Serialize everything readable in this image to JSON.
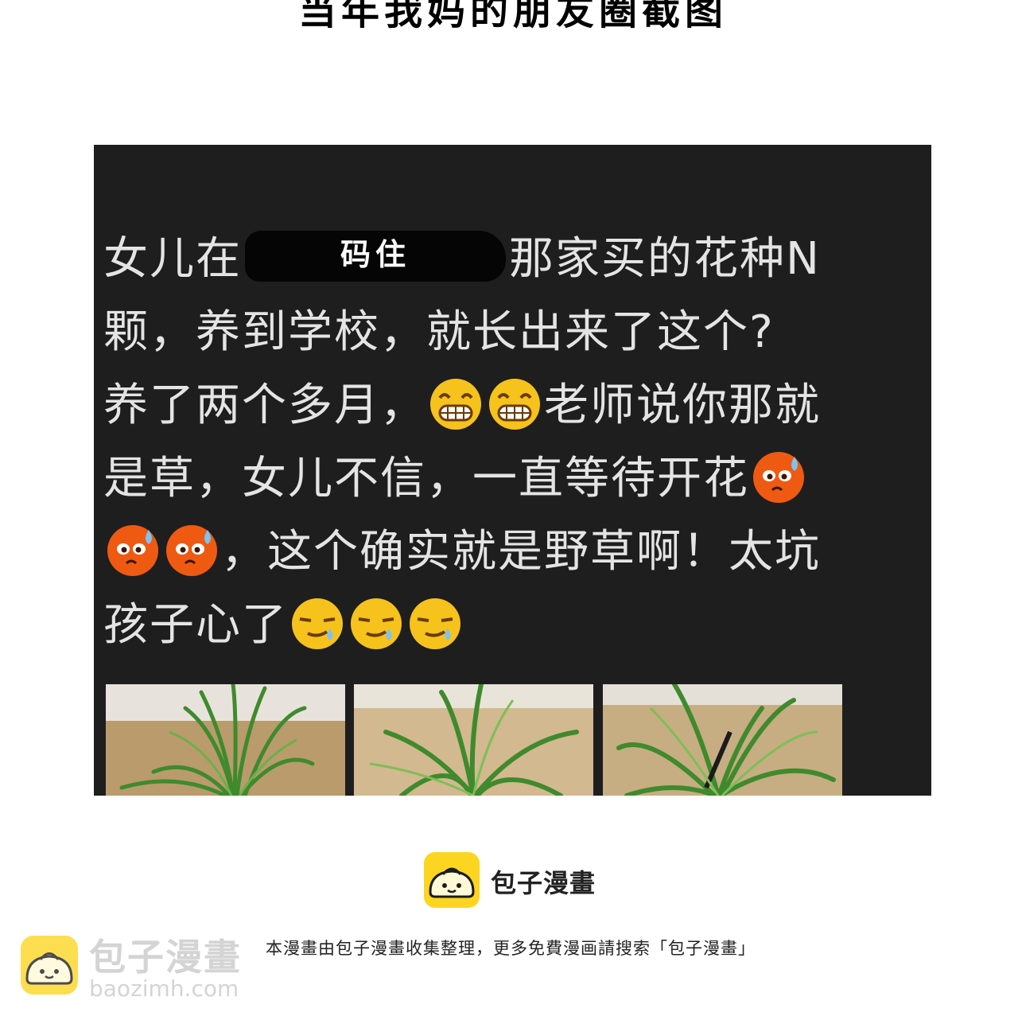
{
  "header": {
    "title": "当年我妈的朋友圈截图"
  },
  "post": {
    "line1_pre": "女儿在",
    "redaction_label": "码住",
    "line1_post": "那家买的花种N",
    "line2": "颗，养到学校，就长出来了这个?",
    "line3_pre": "养了两个多月，",
    "line3_post": "老师说你那就",
    "line4": "是草，女儿不信，一直等待开花",
    "line5_post": "，这个确实就是野草啊！太坑",
    "line6": "孩子心了",
    "emojis": [
      "grin-icon",
      "grin-icon",
      "sweat-worried-icon",
      "sweat-worried-icon",
      "sweat-worried-icon",
      "sweat-smirk-icon",
      "sweat-smirk-icon",
      "sweat-smirk-icon"
    ]
  },
  "photos": [
    {
      "name": "grass-photo-1"
    },
    {
      "name": "grass-photo-2"
    },
    {
      "name": "grass-photo-3"
    }
  ],
  "brand": {
    "name": "包子漫畫",
    "logo": "bun-logo-icon",
    "color": "#fcd520"
  },
  "footer": {
    "note": "本漫畫由包子漫畫收集整理，更多免費漫画請搜索「包子漫畫」"
  },
  "watermark": {
    "name": "包子漫畫",
    "url": "baozimh.com"
  }
}
